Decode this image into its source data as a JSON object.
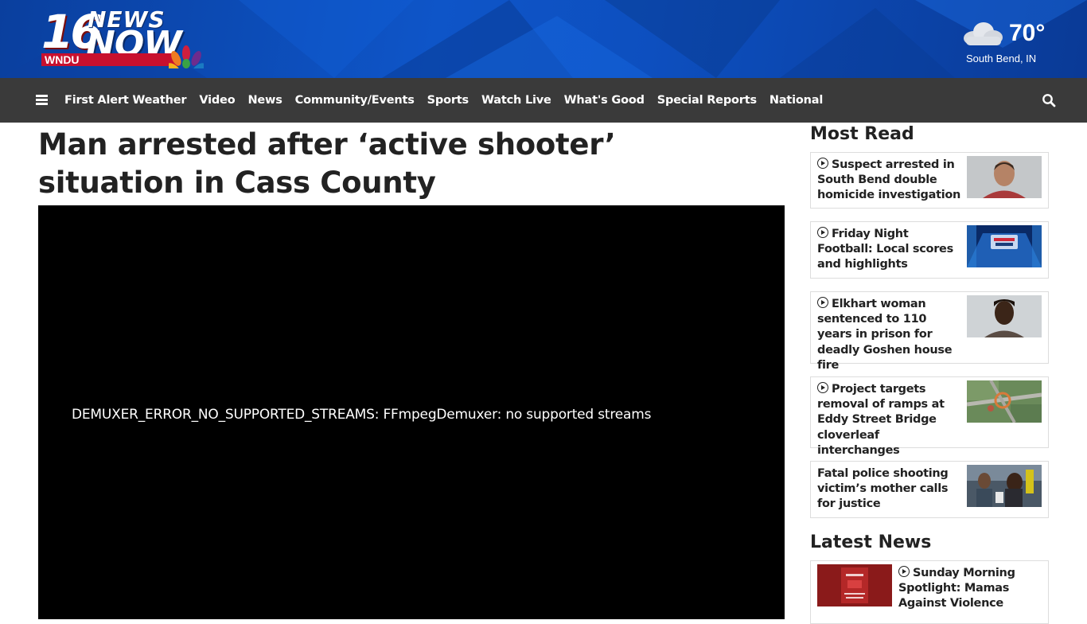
{
  "header": {
    "logo": {
      "number": "16",
      "word1": "NEWS",
      "word2": "NOW",
      "callsign": "WNDU"
    },
    "weather": {
      "icon": "cloud-icon",
      "temperature": "70°",
      "location": "South Bend, IN"
    }
  },
  "nav": {
    "menu_icon": "hamburger-menu-icon",
    "items": [
      {
        "label": "First Alert Weather"
      },
      {
        "label": "Video"
      },
      {
        "label": "News"
      },
      {
        "label": "Community/Events"
      },
      {
        "label": "Sports"
      },
      {
        "label": "Watch Live"
      },
      {
        "label": "What's Good"
      },
      {
        "label": "Special Reports"
      },
      {
        "label": "National"
      }
    ],
    "search_icon": "search-icon"
  },
  "article": {
    "headline": "Man arrested after ‘active shooter’ situation in Cass County",
    "video_error": "DEMUXER_ERROR_NO_SUPPORTED_STREAMS: FFmpegDemuxer: no supported streams"
  },
  "sidebar": {
    "most_read_title": "Most Read",
    "most_read": [
      {
        "title": "Suspect arrested in South Bend double homicide investigation",
        "video": true
      },
      {
        "title": "Friday Night Football: Local scores and highlights",
        "video": true
      },
      {
        "title": "Elkhart woman sentenced to 110 years in prison for deadly Goshen house fire",
        "video": true
      },
      {
        "title": "Project targets removal of ramps at Eddy Street Bridge cloverleaf interchanges",
        "video": true
      },
      {
        "title": "Fatal police shooting victim’s mother calls for justice",
        "video": false
      }
    ],
    "latest_title": "Latest News",
    "latest": [
      {
        "title": "Sunday Morning Spotlight: Mamas Against Violence",
        "video": true
      }
    ]
  },
  "colors": {
    "header_blue": "#0e55c8",
    "nav_bg": "#3a3a3a",
    "brand_red": "#c8102e"
  }
}
